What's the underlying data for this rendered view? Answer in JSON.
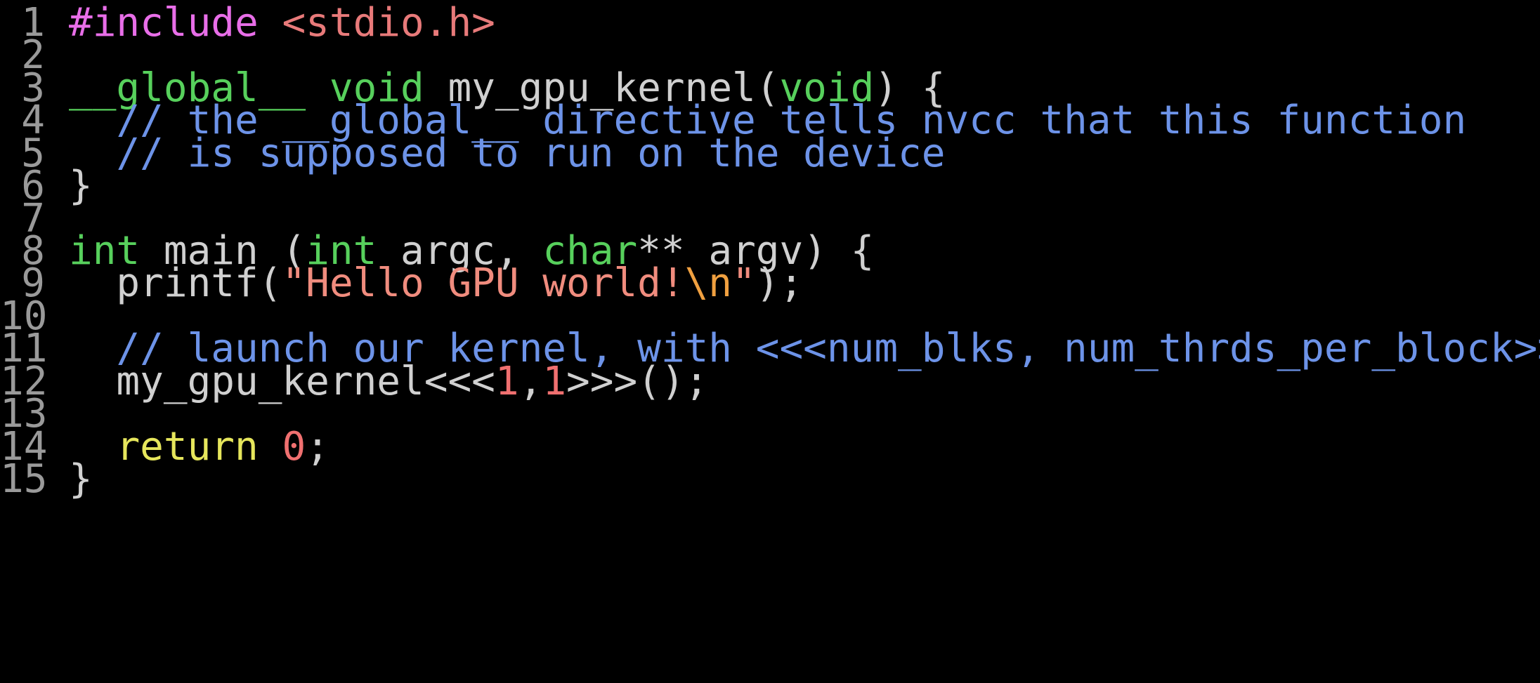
{
  "colors": {
    "background": "#000000",
    "line_number": "#9a9a9a",
    "plain": "#d0d0d0",
    "preprocessor": "#e86ee8",
    "include_path": "#e87a7a",
    "type_keyword": "#57d05c",
    "control_keyword": "#e6e65c",
    "comment": "#6d93e8",
    "string": "#f08c7e",
    "escape": "#f0a040",
    "number": "#f07070"
  },
  "lines": [
    {
      "num": "1",
      "tokens": [
        {
          "t": "#include",
          "c": "t-pre"
        },
        {
          "t": " ",
          "c": "t-plain"
        },
        {
          "t": "<stdio.h>",
          "c": "t-inc"
        }
      ]
    },
    {
      "num": "2",
      "tokens": []
    },
    {
      "num": "3",
      "tokens": [
        {
          "t": "__global__",
          "c": "t-kw"
        },
        {
          "t": " ",
          "c": "t-plain"
        },
        {
          "t": "void",
          "c": "t-kw"
        },
        {
          "t": " my_gpu_kernel(",
          "c": "t-plain"
        },
        {
          "t": "void",
          "c": "t-kw"
        },
        {
          "t": ") {",
          "c": "t-plain"
        }
      ]
    },
    {
      "num": "4",
      "tokens": [
        {
          "t": "  ",
          "c": "t-plain"
        },
        {
          "t": "// the __global__ directive tells nvcc that this function",
          "c": "t-com"
        }
      ]
    },
    {
      "num": "5",
      "tokens": [
        {
          "t": "  ",
          "c": "t-plain"
        },
        {
          "t": "// is supposed to run on the device",
          "c": "t-com"
        }
      ]
    },
    {
      "num": "6",
      "tokens": [
        {
          "t": "}",
          "c": "t-plain"
        }
      ]
    },
    {
      "num": "7",
      "tokens": []
    },
    {
      "num": "8",
      "tokens": [
        {
          "t": "int",
          "c": "t-kw"
        },
        {
          "t": " main (",
          "c": "t-plain"
        },
        {
          "t": "int",
          "c": "t-kw"
        },
        {
          "t": " argc, ",
          "c": "t-plain"
        },
        {
          "t": "char",
          "c": "t-kw"
        },
        {
          "t": "** argv) {",
          "c": "t-plain"
        }
      ]
    },
    {
      "num": "9",
      "tokens": [
        {
          "t": "  printf(",
          "c": "t-plain"
        },
        {
          "t": "\"Hello GPU world!",
          "c": "t-str"
        },
        {
          "t": "\\n",
          "c": "t-esc"
        },
        {
          "t": "\"",
          "c": "t-str"
        },
        {
          "t": ");",
          "c": "t-plain"
        }
      ]
    },
    {
      "num": "10",
      "tokens": []
    },
    {
      "num": "11",
      "tokens": [
        {
          "t": "  ",
          "c": "t-plain"
        },
        {
          "t": "// launch our kernel, with <<<num_blks, num_thrds_per_block>>>",
          "c": "t-com"
        }
      ]
    },
    {
      "num": "12",
      "tokens": [
        {
          "t": "  my_gpu_kernel<<<",
          "c": "t-plain"
        },
        {
          "t": "1",
          "c": "t-num"
        },
        {
          "t": ",",
          "c": "t-plain"
        },
        {
          "t": "1",
          "c": "t-num"
        },
        {
          "t": ">>>();",
          "c": "t-plain"
        }
      ]
    },
    {
      "num": "13",
      "tokens": []
    },
    {
      "num": "14",
      "tokens": [
        {
          "t": "  ",
          "c": "t-plain"
        },
        {
          "t": "return",
          "c": "t-ctl"
        },
        {
          "t": " ",
          "c": "t-plain"
        },
        {
          "t": "0",
          "c": "t-num"
        },
        {
          "t": ";",
          "c": "t-plain"
        }
      ]
    },
    {
      "num": "15",
      "tokens": [
        {
          "t": "}",
          "c": "t-plain"
        }
      ]
    }
  ]
}
